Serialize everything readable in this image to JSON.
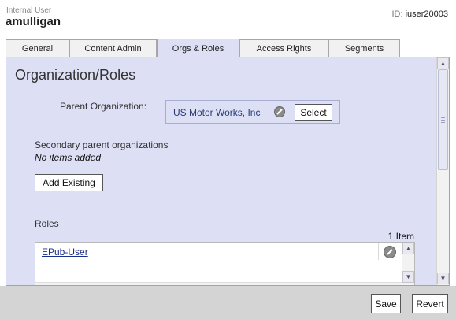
{
  "header": {
    "user_type": "Internal User",
    "user_name": "amulligan",
    "id_label": "ID:",
    "id_value": "iuser20003"
  },
  "tabs": [
    {
      "label": "General",
      "active": false
    },
    {
      "label": "Content Admin",
      "active": false
    },
    {
      "label": "Orgs & Roles",
      "active": true
    },
    {
      "label": "Access Rights",
      "active": false
    },
    {
      "label": "Segments",
      "active": false
    }
  ],
  "section": {
    "title": "Organization/Roles",
    "parent_org_label": "Parent Organization:",
    "parent_org_value": "US Motor Works, Inc",
    "select_label": "Select",
    "secondary_label": "Secondary parent organizations",
    "secondary_empty": "No items added",
    "add_existing_label": "Add Existing",
    "roles_label": "Roles",
    "roles_count": "1 Item",
    "roles": [
      "EPub-User"
    ]
  },
  "footer": {
    "save_label": "Save",
    "revert_label": "Revert"
  },
  "icons": {
    "edit": "pencil-disabled-icon",
    "scroll_up": "arrow-up-icon",
    "scroll_down": "arrow-down-icon"
  },
  "colors": {
    "panel_bg": "#dde0f5",
    "footer_bg": "#d4d4d4",
    "link": "#1a2f8a"
  }
}
